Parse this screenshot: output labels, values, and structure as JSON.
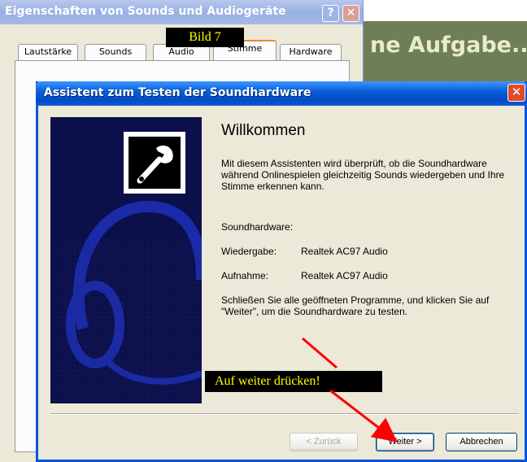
{
  "background_window": {
    "title": "ne Aufgabe.."
  },
  "properties_dialog": {
    "title": "Eigenschaften von Sounds und Audiogeräte",
    "help_button": "?",
    "close_button": "✕",
    "tabs": [
      {
        "label": "Lautstärke",
        "active": false
      },
      {
        "label": "Sounds",
        "active": false
      },
      {
        "label": "Audio",
        "active": false
      },
      {
        "label": "Stimme",
        "active": true
      },
      {
        "label": "Hardware",
        "active": false
      }
    ]
  },
  "bild_label": "Bild 7",
  "wizard": {
    "title": "Assistent zum Testen der Soundhardware",
    "close_button": "✕",
    "heading": "Willkommen",
    "intro": "Mit diesem Assistenten wird überprüft, ob die Soundhardware während Onlinespielen gleichzeitig Sounds wiedergeben und Ihre Stimme erkennen kann.",
    "hardware_label": "Soundhardware:",
    "playback_label": "Wiedergabe:",
    "playback_value": "Realtek AC97 Audio",
    "recording_label": "Aufnahme:",
    "recording_value": "Realtek AC97 Audio",
    "instructions": "Schließen Sie alle geöffneten Programme, und klicken Sie auf \"Weiter\", um die Soundhardware zu testen.",
    "buttons": {
      "back": "< Zurück",
      "next": "Weiter >",
      "cancel": "Abbrechen"
    }
  },
  "annotation": "Auf weiter drücken!",
  "colors": {
    "wizard_titlebar": "#0a5fd9",
    "wizard_image_bg": "#0b0f4a",
    "annotation_bg": "#000000",
    "annotation_text": "#ffff00",
    "arrow": "#ff0000"
  }
}
